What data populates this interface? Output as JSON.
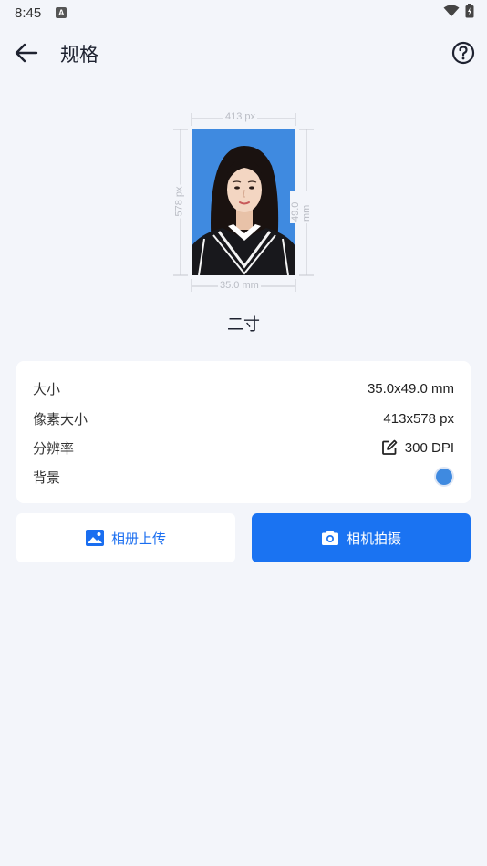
{
  "status": {
    "time": "8:45",
    "notification_letter": "A"
  },
  "header": {
    "title": "规格",
    "back_icon": "arrow-left-icon",
    "help_icon": "help-circle-icon"
  },
  "preview": {
    "width_px_label": "413 px",
    "height_px_label": "578 px",
    "width_mm_label": "35.0 mm",
    "height_mm_label": "49.0 mm",
    "background_color": "#3f8ae0"
  },
  "spec_name": "二寸",
  "info": {
    "size_label": "大小",
    "size_value": "35.0x49.0 mm",
    "pixels_label": "像素大小",
    "pixels_value": "413x578 px",
    "resolution_label": "分辨率",
    "resolution_value": "300 DPI",
    "background_label": "背景",
    "background_color": "#3f8ae0"
  },
  "buttons": {
    "album": "相册上传",
    "camera": "相机拍摄"
  },
  "colors": {
    "accent": "#1a73f2",
    "page_bg": "#f3f5fa"
  }
}
